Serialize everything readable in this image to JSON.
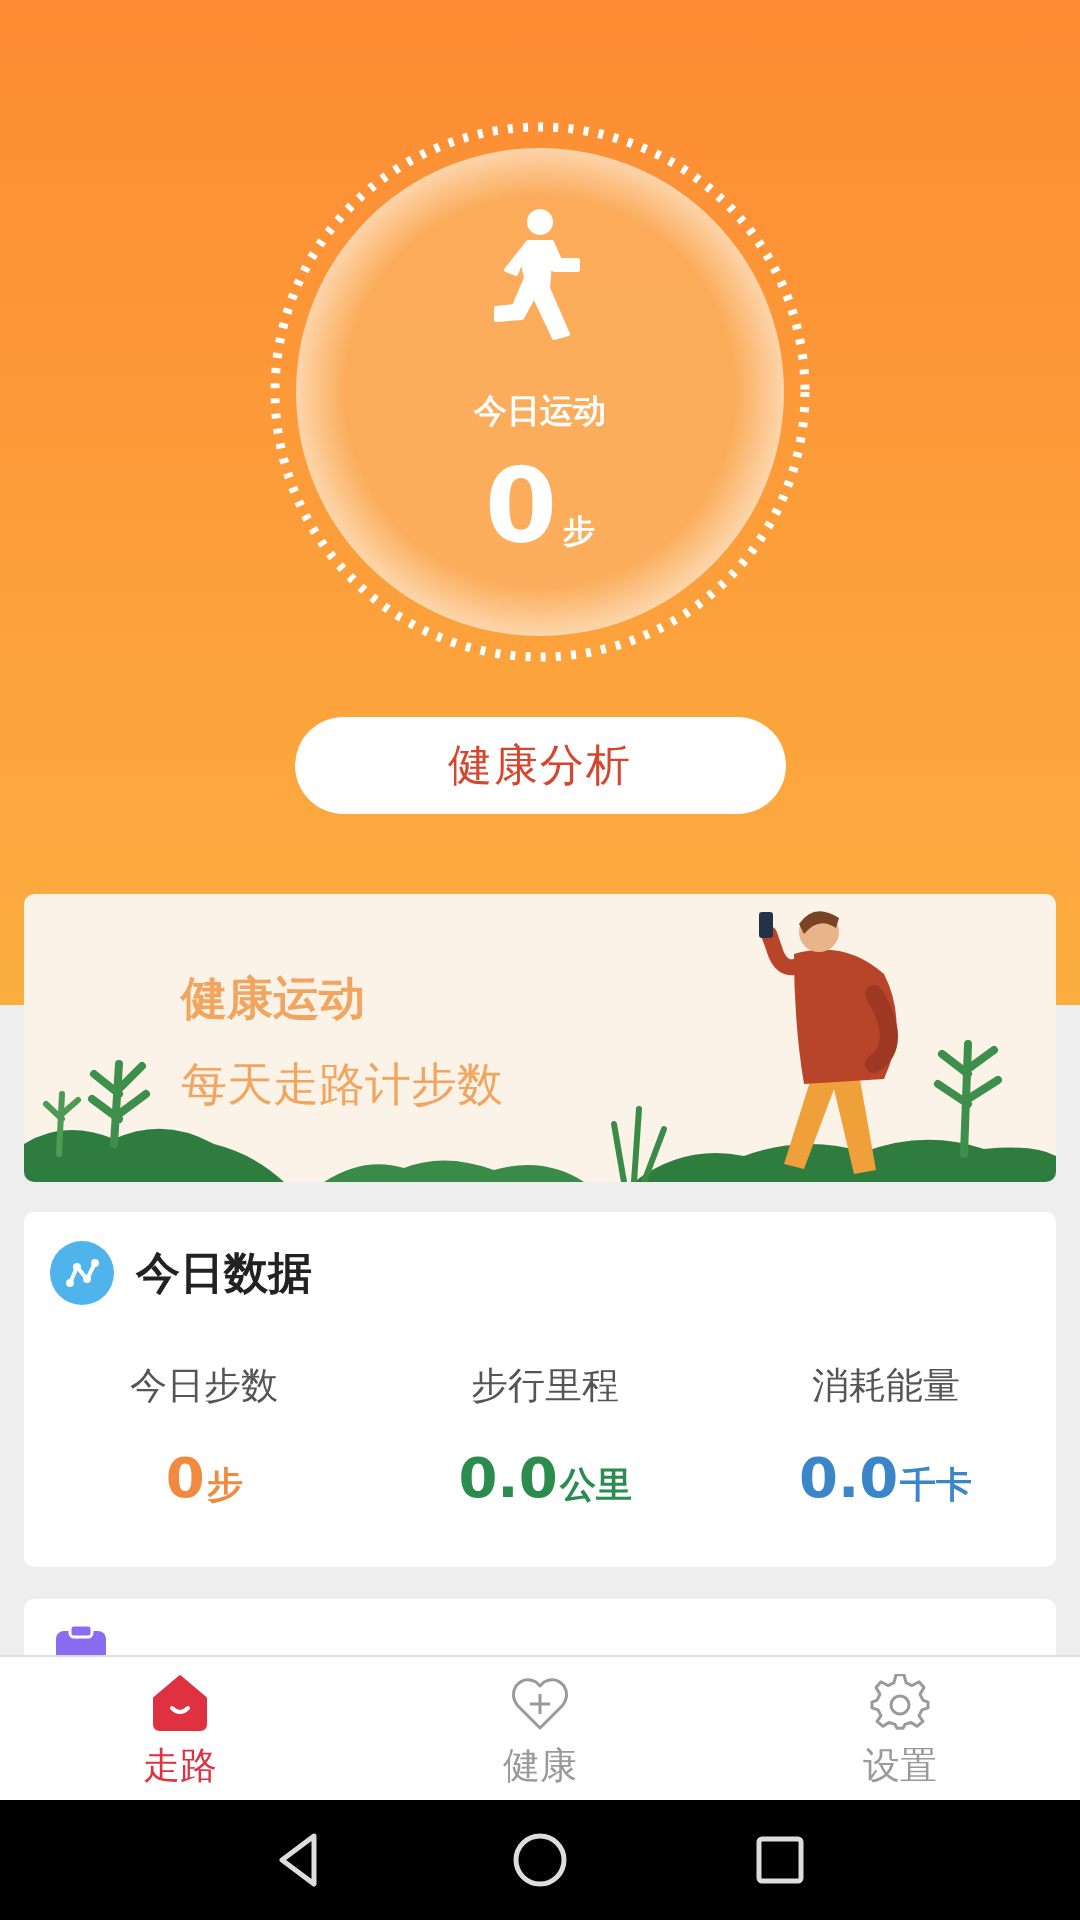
{
  "hero": {
    "title": "今日运动",
    "steps": "0",
    "unit": "步"
  },
  "analysis_button": {
    "label": "健康分析"
  },
  "banner": {
    "headline": "健康运动",
    "slogan": "每天走路计步数"
  },
  "today_data": {
    "title": "今日数据",
    "stats": [
      {
        "label": "今日步数",
        "value": "0",
        "unit": "步",
        "color": "#f08a3e"
      },
      {
        "label": "步行里程",
        "value": "0.0",
        "unit": "公里",
        "color": "#2b8c4e"
      },
      {
        "label": "消耗能量",
        "value": "0.0",
        "unit": "千卡",
        "color": "#3a86c8"
      }
    ]
  },
  "tab_bar": [
    {
      "kind": "home",
      "label": "走路",
      "selected": true
    },
    {
      "kind": "heart",
      "label": "健康",
      "selected": false
    },
    {
      "kind": "gear",
      "label": "设置",
      "selected": false
    }
  ]
}
